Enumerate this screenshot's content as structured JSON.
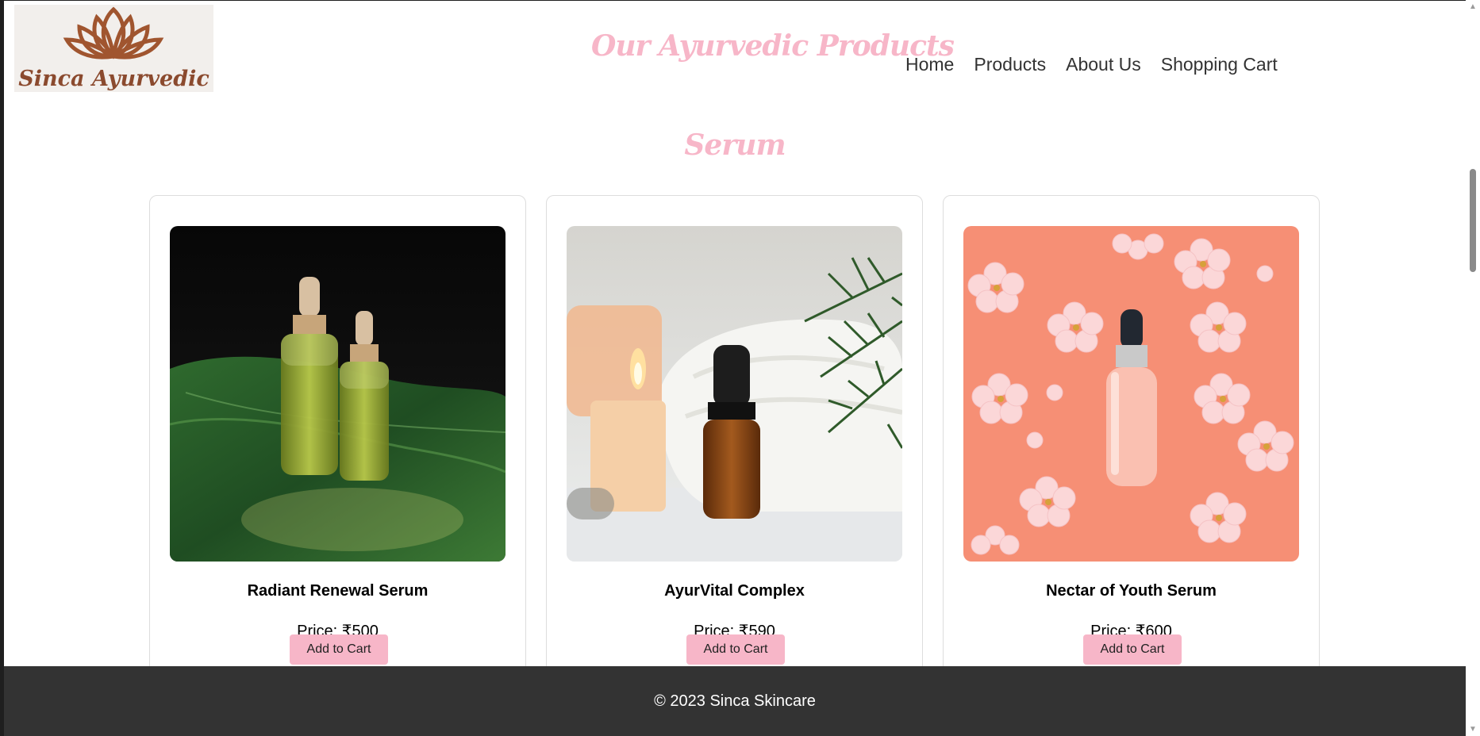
{
  "brand": {
    "logo_text": "Sinca Ayurvedic",
    "logo_color": "#8b4a2e",
    "accent_color": "#f7b6c8"
  },
  "header": {
    "title": "Our Ayurvedic Products",
    "nav": [
      {
        "label": "Home"
      },
      {
        "label": "Products"
      },
      {
        "label": "About Us"
      },
      {
        "label": "Shopping Cart"
      }
    ]
  },
  "section": {
    "title": "Serum"
  },
  "products": [
    {
      "name": "Radiant Renewal Serum",
      "price": "Price: ₹500",
      "button": "Add to Cart",
      "image": "green-serum-bottles-on-leaf"
    },
    {
      "name": "AyurVital Complex",
      "price": "Price: ₹590",
      "button": "Add to Cart",
      "image": "amber-dropper-bottle-with-candles"
    },
    {
      "name": "Nectar of Youth Serum",
      "price": "Price: ₹600",
      "button": "Add to Cart",
      "image": "clear-serum-bottle-on-pink-flowers"
    }
  ],
  "footer": {
    "text": "© 2023 Sinca Skincare"
  },
  "scrollbar": {
    "up_icon": "triangle-up-icon",
    "down_icon": "triangle-down-icon"
  }
}
